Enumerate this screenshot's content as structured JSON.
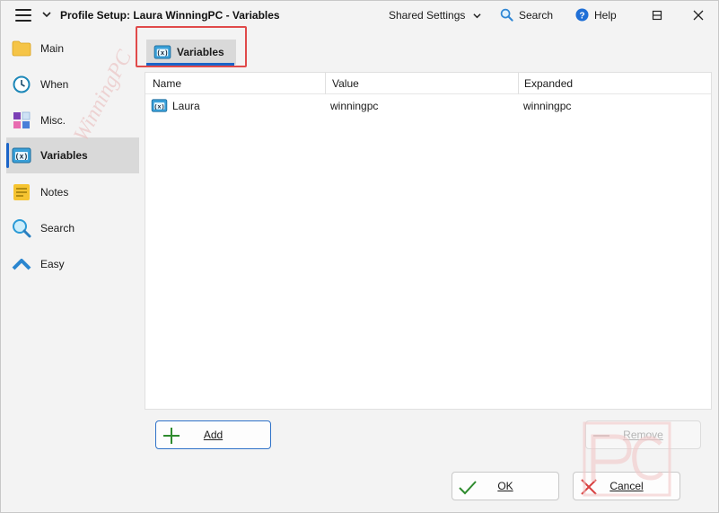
{
  "window": {
    "title": "Profile Setup: Laura WinningPC - Variables",
    "shared_settings_label": "Shared Settings",
    "search_label": "Search",
    "help_label": "Help"
  },
  "sidebar": {
    "items": [
      {
        "label": "Main",
        "icon": "folder-icon"
      },
      {
        "label": "When",
        "icon": "clock-icon"
      },
      {
        "label": "Misc.",
        "icon": "blocks-icon"
      },
      {
        "label": "Variables",
        "icon": "variables-icon",
        "active": true
      },
      {
        "label": "Notes",
        "icon": "notes-icon"
      },
      {
        "label": "Search",
        "icon": "magnifier-icon"
      },
      {
        "label": "Easy",
        "icon": "chevron-up-icon"
      }
    ]
  },
  "tab": {
    "label": "Variables"
  },
  "table": {
    "columns": [
      "Name",
      "Value",
      "Expanded"
    ],
    "rows": [
      {
        "name": "Laura",
        "value": "winningpc",
        "expanded": "winningpc"
      }
    ]
  },
  "buttons": {
    "add": "Add",
    "remove": "Remove",
    "ok": "OK",
    "cancel": "Cancel"
  },
  "colors": {
    "accent": "#1a64c8",
    "highlight_border": "#e04a4a",
    "add_icon": "#2e8b2e",
    "cancel_icon": "#d94040"
  }
}
